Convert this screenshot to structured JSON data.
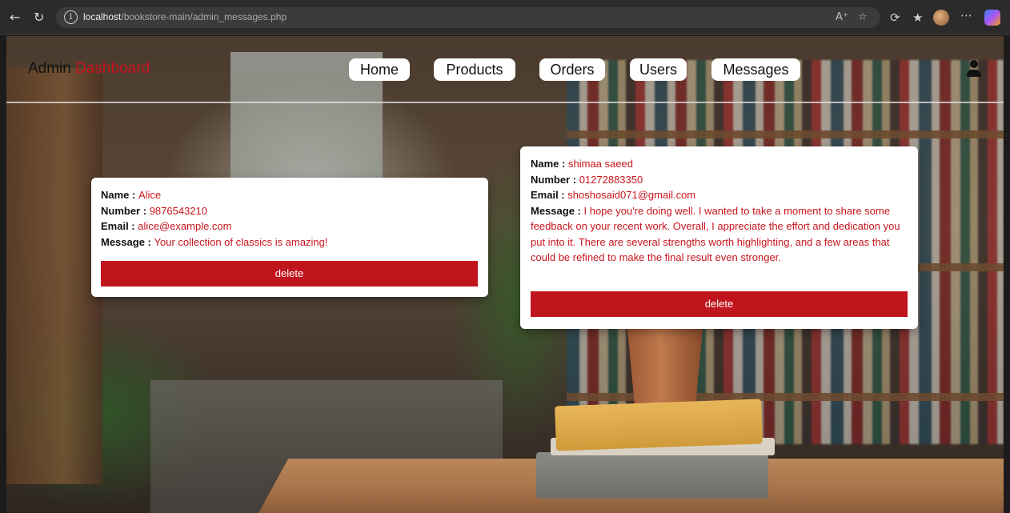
{
  "browser": {
    "url_host": "localhost",
    "url_path": "/bookstore-main/admin_messages.php"
  },
  "header": {
    "logo_primary": "Admin",
    "logo_accent": "Dashboard",
    "nav": [
      "Home",
      "Products",
      "Orders",
      "Users",
      "Messages"
    ]
  },
  "labels": {
    "name": "Name :",
    "number": "Number :",
    "email": "Email :",
    "message": "Message :"
  },
  "messages": [
    {
      "name": "Alice",
      "number": "9876543210",
      "email": "alice@example.com",
      "message": "Your collection of classics is amazing!",
      "delete_label": "delete"
    },
    {
      "name": "shimaa saeed",
      "number": "01272883350",
      "email": "shoshosaid071@gmail.com",
      "message": "I hope you're doing well. I wanted to take a moment to share some feedback on your recent work. Overall, I appreciate the effort and dedication you put into it. There are several strengths worth highlighting, and a few areas that could be refined to make the final result even stronger.",
      "delete_label": "delete"
    }
  ],
  "colors": {
    "accent": "#c8151d",
    "delete_button": "#c0151d"
  },
  "icons": [
    "back-icon",
    "refresh-icon",
    "info-icon",
    "read-aloud-icon",
    "favorite-star-icon",
    "collections-icon",
    "favorites-bar-icon",
    "profile-avatar-icon",
    "more-icon",
    "copilot-icon",
    "user-icon"
  ]
}
